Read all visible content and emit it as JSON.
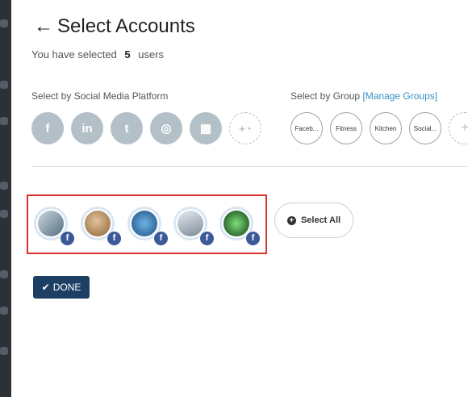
{
  "header": {
    "back_icon": "arrow-left-icon",
    "title": "Select Accounts"
  },
  "summary": {
    "prefix": "You have selected",
    "count": "5",
    "suffix": "users"
  },
  "platform_section": {
    "label": "Select by Social Media Platform",
    "platforms": [
      {
        "name": "facebook",
        "glyph": "f"
      },
      {
        "name": "linkedin",
        "glyph": "in"
      },
      {
        "name": "twitter",
        "glyph": "t"
      },
      {
        "name": "instagram",
        "glyph": "◎"
      },
      {
        "name": "google-my-business",
        "glyph": "▦"
      }
    ],
    "add_glyph": "+◔"
  },
  "group_section": {
    "label": "Select by Group",
    "manage_link": "[Manage Groups]",
    "groups": [
      "Faceb...",
      "Fitness",
      "Kitchen",
      "Social..."
    ],
    "add_glyph": "+"
  },
  "accounts": [
    {
      "name": "account-1",
      "network": "facebook",
      "badge": "f",
      "color": "#7f9aae"
    },
    {
      "name": "account-2",
      "network": "facebook",
      "badge": "f",
      "color": "#b48a5b"
    },
    {
      "name": "account-3",
      "network": "facebook",
      "badge": "f",
      "color": "#2e6fa8"
    },
    {
      "name": "account-4",
      "network": "facebook",
      "badge": "f",
      "color": "#9aa7b4"
    },
    {
      "name": "account-5",
      "network": "facebook",
      "badge": "f",
      "color": "#1f6b2a"
    }
  ],
  "select_all_label": "Select All",
  "done_label": "DONE",
  "colors": {
    "accent": "#3a8fc7",
    "done_bg": "#1d3f63",
    "highlight": "#d8302f",
    "platform_icon_bg": "#b4c0c8"
  }
}
